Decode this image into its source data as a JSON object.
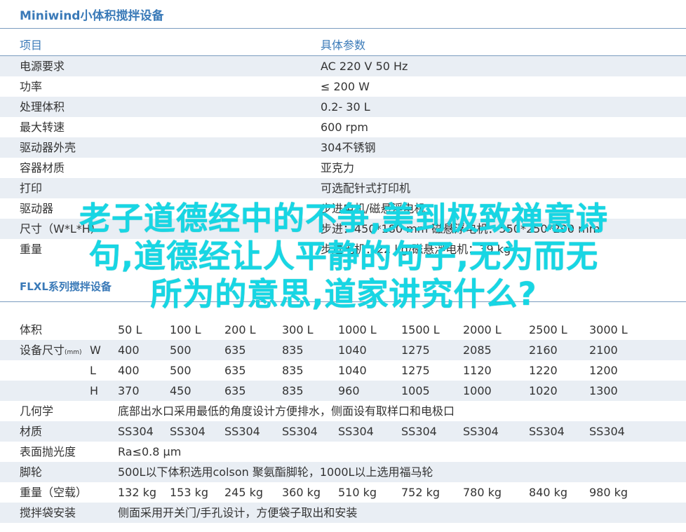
{
  "title": "Miniwind小体积搅拌设备",
  "spec": {
    "headers": [
      "项目",
      "具体参数"
    ],
    "rows": [
      [
        "电源要求",
        "AC 220  V 50 Hz"
      ],
      [
        "功率",
        "≤ 200 W"
      ],
      [
        "处理体积",
        "0.2- 30 L"
      ],
      [
        "最大转速",
        "600  rpm"
      ],
      [
        "驱动器外壳",
        "304不锈钢"
      ],
      [
        "容器材质",
        "亚克力"
      ],
      [
        "打印",
        "可选配针式打印机"
      ],
      [
        "驱动器",
        "步进电机/磁悬浮电机"
      ],
      [
        "尺寸（W*L*H）",
        "步进：450*180 mm 磁悬浮电机：550*250*290 mm"
      ],
      [
        "重量",
        "步进电机：22 kg/磁悬浮电机：39 kg"
      ]
    ]
  },
  "section2_title": "FLXL系列搅拌设备",
  "flxl": {
    "volume_label": "体积",
    "volumes": [
      "50 L",
      "100 L",
      "200 L",
      "300 L",
      "1000 L",
      "1500 L",
      "2000 L",
      "2500 L",
      "3000 L"
    ],
    "size_label": "设备尺寸",
    "size_unit": "(mm)",
    "dims": [
      {
        "axis": "W",
        "values": [
          "400",
          "500",
          "635",
          "835",
          "1040",
          "1275",
          "2085",
          "2160",
          "2100"
        ]
      },
      {
        "axis": "L",
        "values": [
          "400",
          "500",
          "635",
          "835",
          "1040",
          "1275",
          "1120",
          "1220",
          "1200"
        ]
      },
      {
        "axis": "H",
        "values": [
          "370",
          "450",
          "635",
          "835",
          "960",
          "1005",
          "1000",
          "1020",
          "1300"
        ]
      }
    ],
    "geometry_label": "几何学",
    "geometry_text": "底部出水口采用最低的角度设计方便排水，侧面设有取样口和电极口",
    "material_label": "材质",
    "materials": [
      "SS304",
      "SS304",
      "SS304",
      "SS304",
      "SS304",
      "SS304",
      "SS304",
      "SS304",
      "SS304"
    ],
    "polish_label": "表面抛光度",
    "polish_text": "Ra≤0.8 μm",
    "caster_label": "脚轮",
    "caster_text": "500L以下体积选用colson 聚氨酯脚轮，1000L以上选用福马轮",
    "weight_label": "重量（空载）",
    "weights": [
      "132 kg",
      "153 kg",
      "245 kg",
      "360 kg",
      "510 kg",
      "752 kg",
      "780 kg",
      "840 kg",
      "980 kg"
    ],
    "bag_label": "搅拌袋安装",
    "bag_text": "侧面采用开关门/手孔设计，方便袋子取出和安装"
  },
  "overlay": {
    "line1": "老子道德经中的不争,美到极致禅意诗",
    "line2": "句,道德经让人平静的句子,无为而无",
    "line3": "所为的意思,道家讲究什么?"
  }
}
